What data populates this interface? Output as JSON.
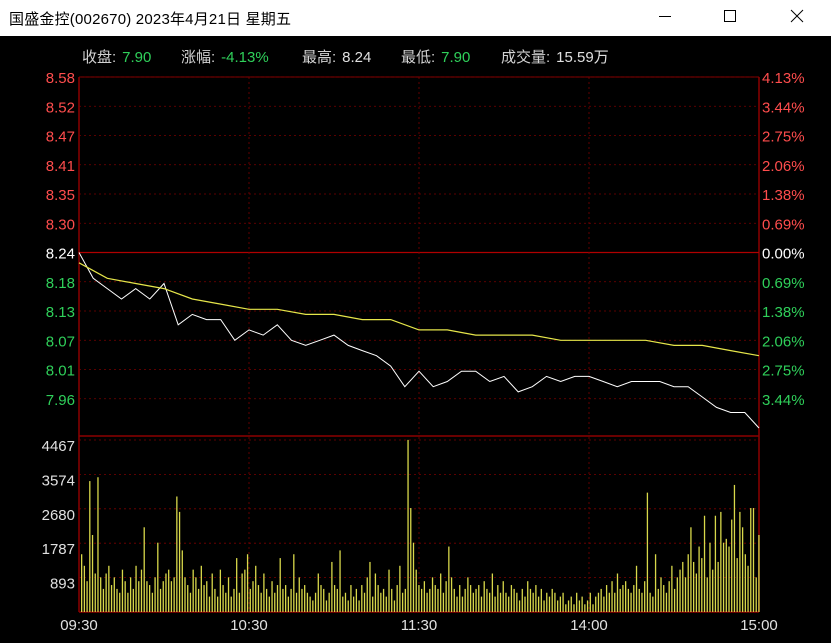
{
  "window": {
    "title": "国盛金控(002670)  2023年4月21日  星期五",
    "minimize_icon": "minimize-icon",
    "maximize_icon": "maximize-icon",
    "close_icon": "close-icon"
  },
  "stats": {
    "close_label": "收盘:",
    "close_value": "7.90",
    "change_label": "涨幅:",
    "change_value": "-4.13%",
    "high_label": "最高:",
    "high_value": "8.24",
    "low_label": "最低:",
    "low_value": "7.90",
    "volume_label": "成交量:",
    "volume_value": "15.59万"
  },
  "colors": {
    "up": "#ff4d4d",
    "down": "#2fd05a",
    "flat": "#ffffff",
    "price_line": "#ffffff",
    "avg_line": "#e6e64a",
    "volume_bar": "#d8d84a",
    "grid": "#7a0000",
    "frame": "#8c0000"
  },
  "chart_data": {
    "type": "line",
    "prev_close": 8.24,
    "price_axis": {
      "labels": [
        "8.58",
        "8.52",
        "8.47",
        "8.41",
        "8.35",
        "8.30",
        "8.24",
        "8.18",
        "8.13",
        "8.07",
        "8.01",
        "7.96"
      ],
      "ylim": [
        7.9,
        8.58
      ]
    },
    "pct_axis": {
      "labels": [
        "4.13%",
        "3.44%",
        "2.75%",
        "2.06%",
        "1.38%",
        "0.69%",
        "0.00%",
        "0.69%",
        "1.38%",
        "2.06%",
        "2.75%",
        "3.44%"
      ]
    },
    "volume_axis": {
      "labels": [
        "4467",
        "3574",
        "2680",
        "1787",
        "893"
      ],
      "ylim": [
        0,
        4467
      ]
    },
    "x_ticks": [
      "09:30",
      "10:30",
      "11:30",
      "14:00",
      "15:00"
    ],
    "series": [
      {
        "role": "price",
        "x": [
          0,
          5,
          10,
          15,
          20,
          25,
          30,
          35,
          40,
          45,
          50,
          55,
          60,
          65,
          70,
          75,
          80,
          85,
          90,
          95,
          100,
          105,
          110,
          115,
          120,
          125,
          130,
          135,
          140,
          145,
          150,
          155,
          160,
          165,
          170,
          175,
          180,
          185,
          190,
          195,
          200,
          205,
          210,
          215,
          220,
          225,
          230,
          235,
          240
        ],
        "values": [
          8.24,
          8.19,
          8.17,
          8.15,
          8.17,
          8.15,
          8.18,
          8.1,
          8.12,
          8.11,
          8.11,
          8.07,
          8.09,
          8.08,
          8.1,
          8.07,
          8.06,
          8.07,
          8.08,
          8.06,
          8.05,
          8.04,
          8.02,
          7.98,
          8.01,
          7.98,
          7.99,
          8.01,
          8.01,
          7.99,
          8.0,
          7.97,
          7.98,
          8.0,
          7.99,
          8.0,
          8.0,
          7.99,
          7.98,
          7.99,
          7.99,
          7.99,
          7.98,
          7.98,
          7.96,
          7.94,
          7.93,
          7.93,
          7.9
        ]
      },
      {
        "role": "average",
        "x": [
          0,
          10,
          20,
          30,
          40,
          50,
          60,
          70,
          80,
          90,
          100,
          110,
          120,
          130,
          140,
          150,
          160,
          170,
          180,
          190,
          200,
          210,
          220,
          230,
          240
        ],
        "values": [
          8.22,
          8.19,
          8.18,
          8.17,
          8.15,
          8.14,
          8.13,
          8.13,
          8.12,
          8.12,
          8.11,
          8.11,
          8.09,
          8.09,
          8.08,
          8.08,
          8.08,
          8.07,
          8.07,
          8.07,
          8.07,
          8.06,
          8.06,
          8.05,
          8.04
        ]
      }
    ],
    "volume": [
      1500,
      1200,
      800,
      3400,
      2000,
      1000,
      3500,
      900,
      600,
      1000,
      1200,
      700,
      900,
      600,
      500,
      1100,
      800,
      500,
      900,
      600,
      1200,
      800,
      1100,
      2200,
      800,
      700,
      500,
      900,
      1800,
      600,
      800,
      1000,
      1100,
      800,
      900,
      3000,
      2600,
      1600,
      900,
      700,
      500,
      1100,
      900,
      600,
      1200,
      700,
      800,
      400,
      1000,
      600,
      400,
      1100,
      700,
      500,
      900,
      400,
      600,
      1400,
      500,
      1000,
      1100,
      1500,
      600,
      800,
      1200,
      700,
      500,
      1000,
      600,
      400,
      800,
      500,
      700,
      1400,
      600,
      700,
      400,
      600,
      1500,
      500,
      900,
      600,
      700,
      500,
      400,
      300,
      500,
      1000,
      700,
      600,
      300,
      500,
      1300,
      700,
      600,
      1600,
      400,
      500,
      300,
      700,
      400,
      600,
      300,
      700,
      500,
      900,
      1300,
      400,
      1000,
      700,
      500,
      600,
      400,
      1100,
      600,
      300,
      700,
      1200,
      500,
      600,
      4470,
      2700,
      1800,
      1100,
      700,
      600,
      800,
      500,
      600,
      900,
      700,
      600,
      1000,
      500,
      800,
      1700,
      900,
      600,
      400,
      700,
      400,
      600,
      900,
      700,
      500,
      600,
      700,
      400,
      800,
      600,
      500,
      1000,
      400,
      700,
      500,
      800,
      500,
      400,
      700,
      600,
      500,
      300,
      600,
      400,
      800,
      600,
      500,
      700,
      400,
      600,
      300,
      500,
      400,
      600,
      500,
      300,
      400,
      500,
      200,
      300,
      400,
      200,
      500,
      300,
      400,
      200,
      300,
      500,
      200,
      400,
      500,
      600,
      400,
      700,
      500,
      800,
      500,
      1000,
      600,
      700,
      800,
      600,
      500,
      700,
      1200,
      600,
      500,
      800,
      3100,
      500,
      400,
      1500,
      600,
      900,
      700,
      500,
      800,
      1200,
      600,
      900,
      1100,
      1300,
      900,
      1500,
      2200,
      1300,
      1000,
      1700,
      1400,
      2500,
      900,
      1800,
      1100,
      2500,
      1300,
      2600,
      1800,
      1900,
      1700,
      2400,
      3300,
      1400,
      2600,
      2200,
      1500,
      1200,
      2700,
      2700,
      900,
      2000
    ]
  }
}
